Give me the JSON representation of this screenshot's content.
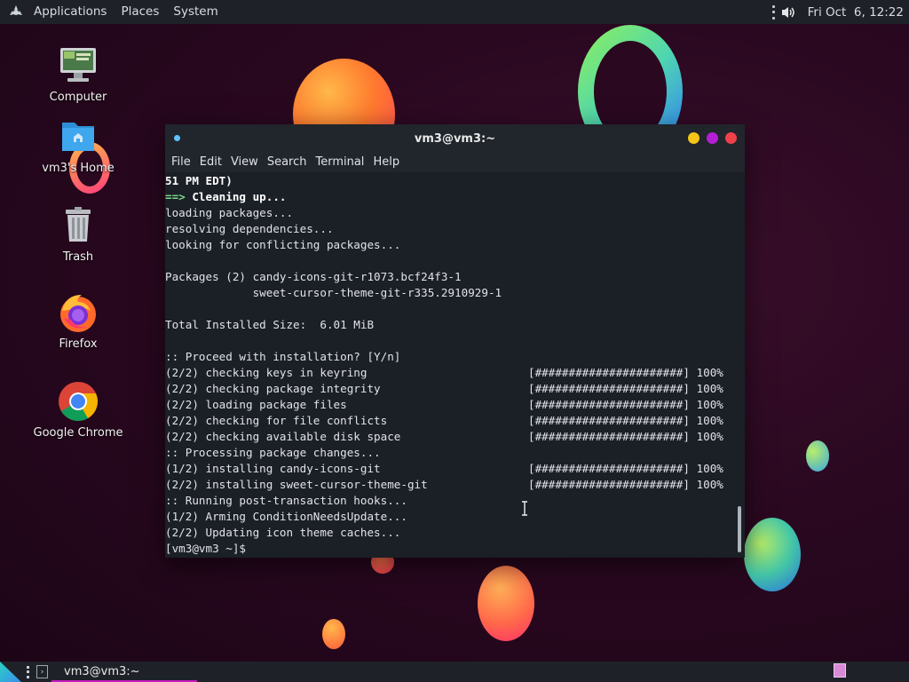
{
  "top_panel": {
    "menus": [
      "Applications",
      "Places",
      "System"
    ],
    "clock": "Fri Oct  6, 12:22"
  },
  "desktop_icons": [
    {
      "label": "Computer",
      "icon": "computer-icon"
    },
    {
      "label": "vm3's Home",
      "icon": "home-folder-icon"
    },
    {
      "label": "Trash",
      "icon": "trash-icon"
    },
    {
      "label": "Firefox",
      "icon": "firefox-icon"
    },
    {
      "label": "Google Chrome",
      "icon": "chrome-icon"
    }
  ],
  "terminal": {
    "title": "vm3@vm3:~",
    "menu": [
      "File",
      "Edit",
      "View",
      "Search",
      "Terminal",
      "Help"
    ],
    "lines": [
      "51 PM EDT)",
      "==> Cleaning up...",
      "loading packages...",
      "resolving dependencies...",
      "looking for conflicting packages...",
      "",
      "Packages (2) candy-icons-git-r1073.bcf24f3-1",
      "             sweet-cursor-theme-git-r335.2910929-1",
      "",
      "Total Installed Size:  6.01 MiB",
      "",
      ":: Proceed with installation? [Y/n]",
      "(2/2) checking keys in keyring",
      "(2/2) checking package integrity",
      "(2/2) loading package files",
      "(2/2) checking for file conflicts",
      "(2/2) checking available disk space",
      ":: Processing package changes...",
      "(1/2) installing candy-icons-git",
      "(2/2) installing sweet-cursor-theme-git",
      ":: Running post-transaction hooks...",
      "(1/2) Arming ConditionNeedsUpdate...",
      "(2/2) Updating icon theme caches...",
      "[vm3@vm3 ~]$"
    ],
    "progress_bar": "[######################] 100%",
    "progress_line_indices": [
      12,
      13,
      14,
      15,
      16,
      18,
      19
    ]
  },
  "taskbar": {
    "window_label": "vm3@vm3:~"
  },
  "colors": {
    "wc_minimize": "#f5c518",
    "wc_maximize": "#b41fd6",
    "wc_close": "#f0404a"
  }
}
